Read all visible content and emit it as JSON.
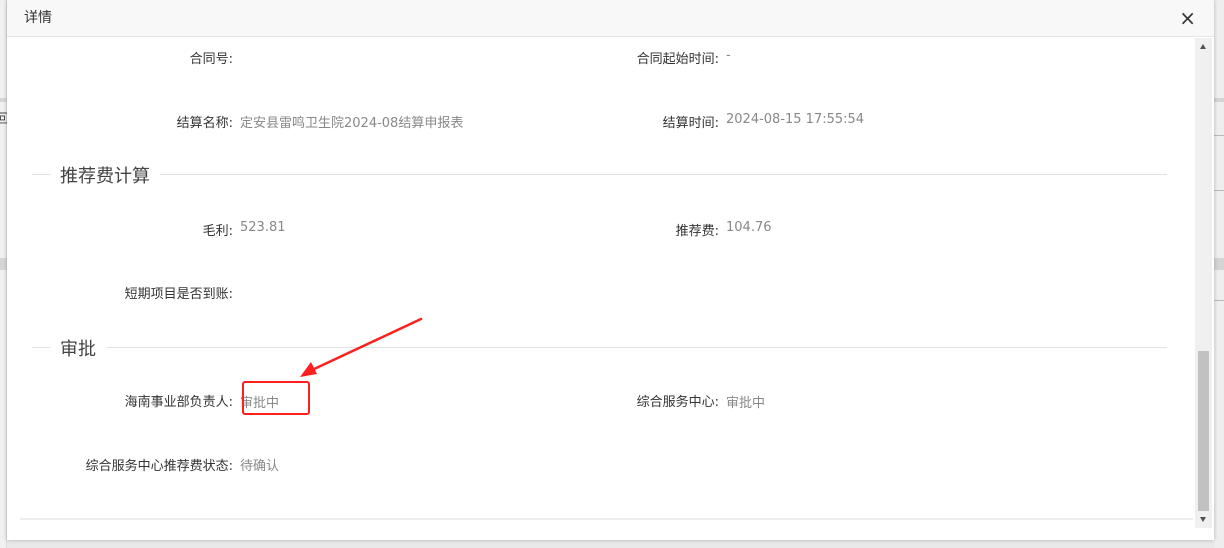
{
  "dialog": {
    "title": "详情",
    "close_icon": "close-icon",
    "close_glyph": "×"
  },
  "background": {
    "left_glyph": "回"
  },
  "info": {
    "contract_no": {
      "label": "合同号:",
      "value": ""
    },
    "contract_start": {
      "label": "合同起始时间:",
      "value": "-"
    },
    "settlement_name": {
      "label": "结算名称:",
      "value": "定安县雷鸣卫生院2024-08结算申报表"
    },
    "settlement_time": {
      "label": "结算时间:",
      "value": "2024-08-15 17:55:54"
    }
  },
  "referral_section": {
    "title": "推荐费计算",
    "gross_profit": {
      "label": "毛利:",
      "value": "523.81"
    },
    "referral_fee": {
      "label": "推荐费:",
      "value": "104.76"
    },
    "short_term_received": {
      "label": "短期项目是否到账:",
      "value": ""
    }
  },
  "approval_section": {
    "title": "审批",
    "hainan_manager": {
      "label": "海南事业部负责人:",
      "value": "审批中"
    },
    "service_center": {
      "label": "综合服务中心:",
      "value": "审批中"
    },
    "service_center_fee_status": {
      "label": "综合服务中心推荐费状态:",
      "value": "待确认"
    }
  },
  "annotation": {
    "highlight_color": "#ff1f1f"
  }
}
